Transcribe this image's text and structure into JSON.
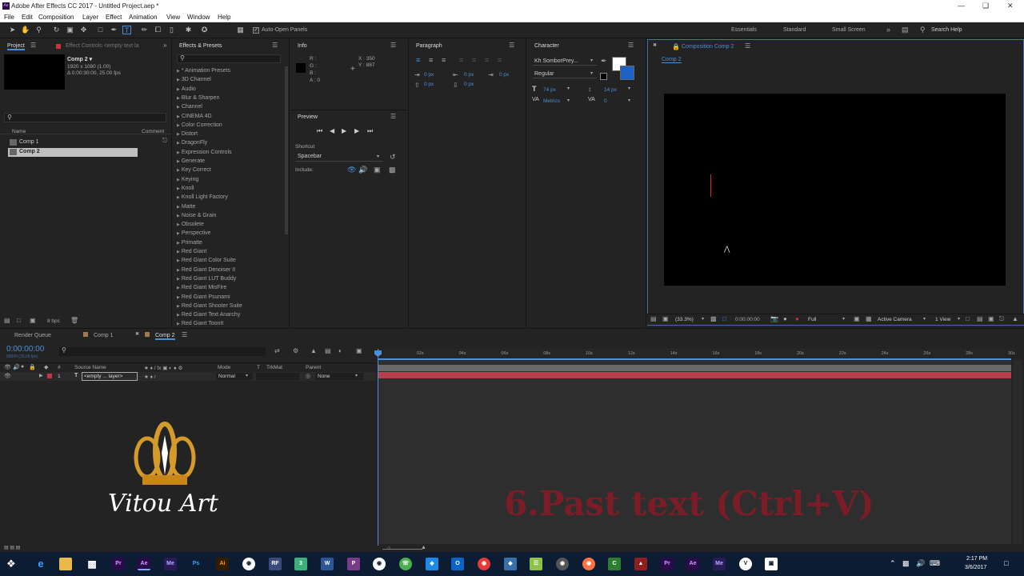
{
  "window": {
    "title": "Adobe After Effects CC 2017 - Untitled Project.aep *",
    "app_icon": "Ae"
  },
  "menu": [
    "File",
    "Edit",
    "Composition",
    "Layer",
    "Effect",
    "Animation",
    "View",
    "Window",
    "Help"
  ],
  "toolbar": {
    "auto_open": "Auto-Open Panels",
    "workspaces": [
      "Essentials",
      "Standard",
      "Small Screen"
    ],
    "search_placeholder": "Search Help"
  },
  "project": {
    "tab": "Project",
    "effect_controls_tab": "Effect Controls <empty text la",
    "comp_name": "Comp 2 ▾",
    "comp_size": "1920 x 1080 (1.00)",
    "comp_duration": "Δ 0:00:30:00, 25.00 fps",
    "col_name": "Name",
    "col_comment": "Comment",
    "items": [
      "Comp 1",
      "Comp 2"
    ],
    "bpc": "8 bpc"
  },
  "effects": {
    "tab": "Effects & Presets",
    "items": [
      "* Animation Presets",
      "3D Channel",
      "Audio",
      "Blur & Sharpen",
      "Channel",
      "CINEMA 4D",
      "Color Correction",
      "Distort",
      "DragonFly",
      "Expression Controls",
      "Generate",
      "Key Correct",
      "Keying",
      "Knoll",
      "Knoll Light Factory",
      "Matte",
      "Noise & Grain",
      "Obsolete",
      "Perspective",
      "Primatte",
      "Red Giant",
      "Red Giant Color Suite",
      "Red Giant Denoiser II",
      "Red Giant LUT Buddy",
      "Red Giant MisFire",
      "Red Giant Psunami",
      "Red Giant Shooter Suite",
      "Red Giant Text Anarchy",
      "Red Giant ToonIt"
    ]
  },
  "info": {
    "tab": "Info",
    "r": "R :",
    "g": "G :",
    "b": "B :",
    "a": "A : 0",
    "x": "X : 350",
    "y": "Y : 887"
  },
  "preview": {
    "tab": "Preview",
    "shortcut_label": "Shortcut",
    "shortcut_value": "Spacebar",
    "include_label": "Include:"
  },
  "paragraph": {
    "tab": "Paragraph",
    "v0": "0 px"
  },
  "character": {
    "tab": "Character",
    "font": "Kh SomborPrey...",
    "style": "Regular",
    "size": "74 px",
    "leading": "14 px",
    "kerning": "Metrics",
    "tracking": "0"
  },
  "composition": {
    "tab": "Composition Comp 2",
    "subtab": "Comp 2",
    "zoom": "(33.3%)",
    "time": "0:00:00:00",
    "resolution": "Full",
    "camera": "Active Camera",
    "view": "1 View"
  },
  "timeline": {
    "tabs": [
      "Render Queue",
      "Comp 1",
      "Comp 2"
    ],
    "timecode": "0:00:00:00",
    "timecode_sub": "00000 (25.00 fps)",
    "col_source": "Source Name",
    "col_mode": "Mode",
    "col_t": "T",
    "col_trkmat": "TrkMat",
    "col_parent": "Parent",
    "layer_num": "1",
    "layer_name": "<empty ... layer>",
    "layer_mode": "Normal",
    "layer_parent": "None",
    "ticks": [
      "00s",
      "02s",
      "04s",
      "06s",
      "08s",
      "10s",
      "12s",
      "14s",
      "16s",
      "18s",
      "20s",
      "22s",
      "24s",
      "26s",
      "28s",
      "30s"
    ]
  },
  "watermark": "Vitou Art",
  "instruction": "6.Past text (Ctrl+V)",
  "taskbar": {
    "time": "2:17 PM",
    "date": "3/6/2017"
  },
  "colors": {
    "accent": "#4b8fd8",
    "layer_bar": "#b3404a",
    "instruction": "#7a1d26"
  }
}
